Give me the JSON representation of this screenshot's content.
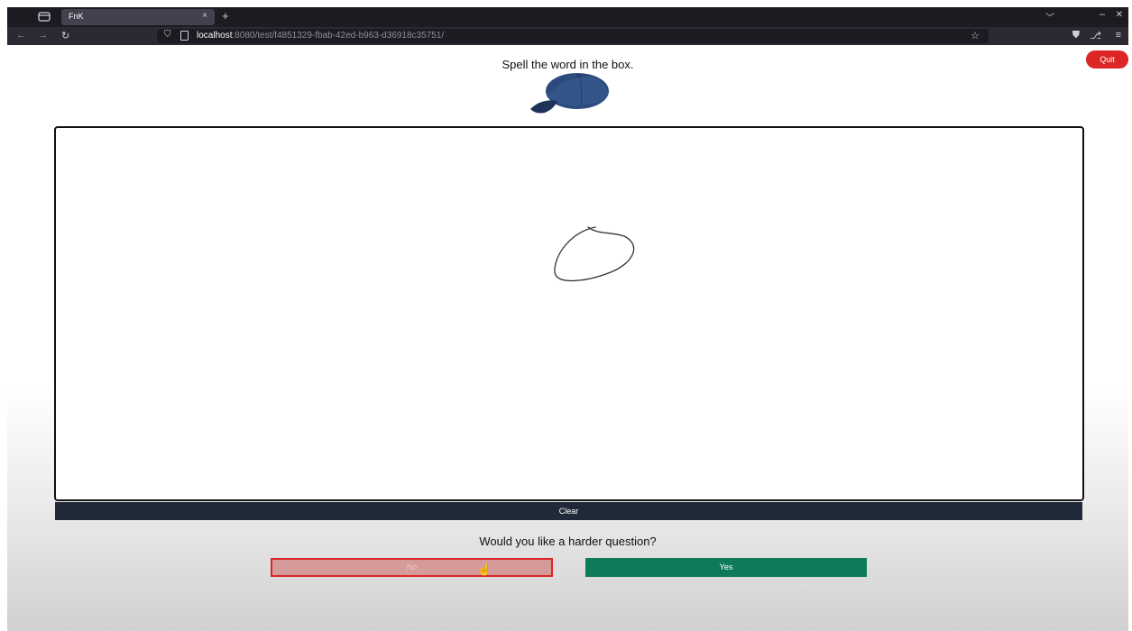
{
  "browser": {
    "tab_title": "FnK",
    "tab_close": "×",
    "new_tab": "+",
    "url_host": "localhost",
    "url_rest": ":8080/test/f4851329-fbab-42ed-b963-d36918c35751/",
    "icons": {
      "tab_overview": "tab-overview-icon",
      "back": "back-arrow-icon",
      "forward": "forward-arrow-icon",
      "reload": "reload-icon",
      "shield": "tracking-shield-icon",
      "page": "page-info-icon",
      "star": "bookmark-star-icon",
      "pocket": "pocket-icon",
      "extensions": "extensions-icon",
      "menu": "hamburger-menu-icon",
      "tab_list": "chevron-down-icon",
      "minimize": "minimize-icon",
      "close": "close-icon"
    }
  },
  "page": {
    "quit_label": "Quit",
    "prompt": "Spell the word in the box.",
    "image": "baseball-cap",
    "clear_label": "Clear",
    "question": "Would you like a harder question?",
    "no_label": "No",
    "yes_label": "Yes"
  },
  "colors": {
    "quit": "#dc2626",
    "clear_bg": "#1f2937",
    "no_bg": "#d59a9a",
    "no_border": "#dc2626",
    "yes_bg": "#0f7a5a",
    "cap": "#2c4a7c"
  }
}
